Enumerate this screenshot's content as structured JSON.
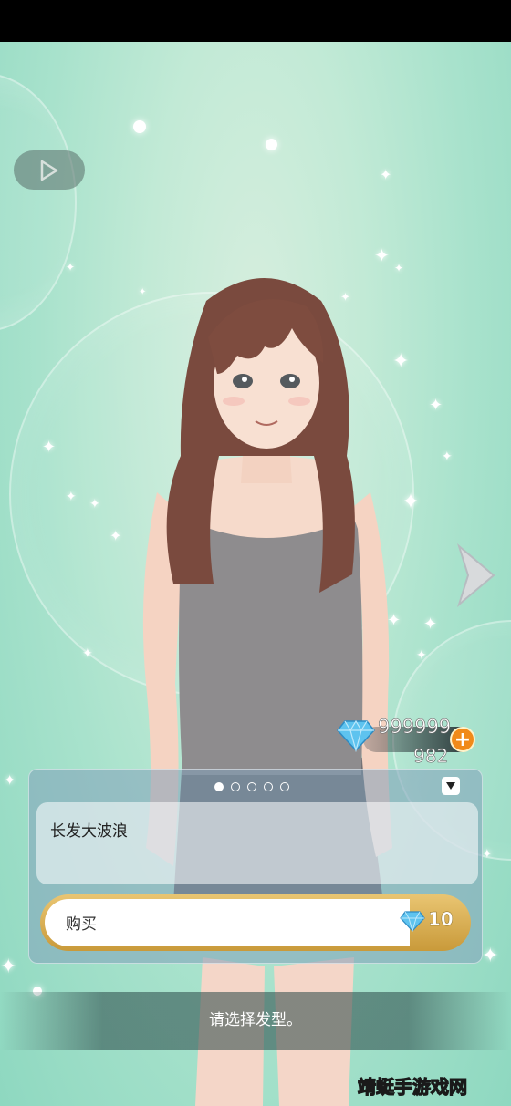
{
  "hud": {
    "play_icon": "play-icon",
    "next_icon": "chevron-right-icon"
  },
  "currency": {
    "gems": "999999",
    "sub_value": "982",
    "add_icon": "plus-icon",
    "gem_icon": "diamond-icon"
  },
  "panel": {
    "pages_total": 5,
    "page_active": 1,
    "collapse_icon": "triangle-down-icon",
    "item_name": "长发大波浪",
    "buy_label": "购买",
    "price": "10",
    "price_icon": "diamond-icon"
  },
  "prompt": "请选择发型。",
  "watermark": "靖蜓手游戏网",
  "colors": {
    "background": "#a8e2cc",
    "accent_orange": "#f08a1a",
    "gold": "#d4a850",
    "gem_blue": "#4fb6e8"
  }
}
